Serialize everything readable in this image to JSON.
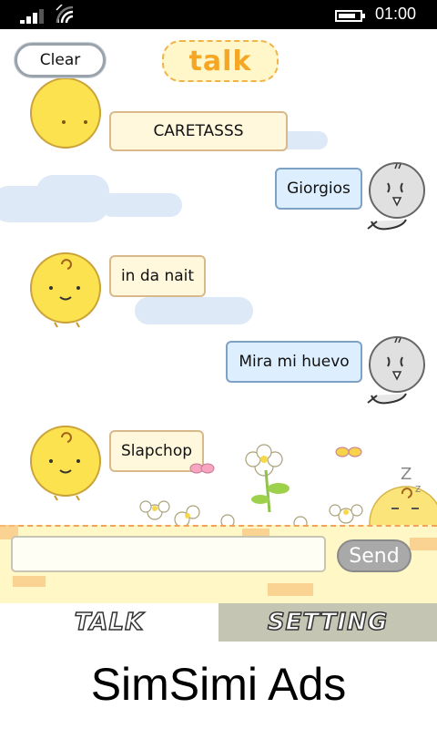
{
  "status_bar": {
    "time": "01:00"
  },
  "header": {
    "clear_label": "Clear",
    "title": "talk"
  },
  "messages": [
    {
      "from": "bot",
      "text": "CARETASSS"
    },
    {
      "from": "user",
      "text": "Giorgios"
    },
    {
      "from": "bot",
      "text": "in da nait"
    },
    {
      "from": "user",
      "text": "Mira mi huevo"
    },
    {
      "from": "bot",
      "text": "Slapchop"
    }
  ],
  "input": {
    "value": "",
    "placeholder": "",
    "send_label": "Send"
  },
  "tabs": [
    {
      "label": "TALK",
      "selected": true
    },
    {
      "label": "SETTING",
      "selected": false
    }
  ],
  "ads": {
    "text": "SimSimi Ads"
  },
  "colors": {
    "bot_bubble": "#fff8dc",
    "user_bubble": "#ddeeff",
    "title": "#f5a623",
    "input_band": "#fff7c6",
    "setting_tab": "#c5c5b4"
  }
}
